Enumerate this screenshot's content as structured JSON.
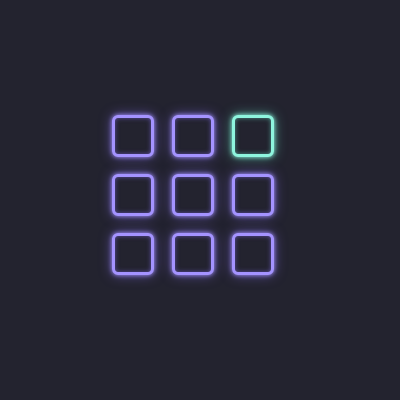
{
  "colors": {
    "background": "#23232f",
    "tile": "#a493ff",
    "tile_glow": "rgba(140,115,255,0.55)",
    "active": "#8ef5de",
    "active_glow": "rgba(110,240,210,0.55)"
  },
  "grid": {
    "rows": 3,
    "columns": 3,
    "active_index": 2
  },
  "icons": {
    "tile": "rounded-square-icon"
  }
}
